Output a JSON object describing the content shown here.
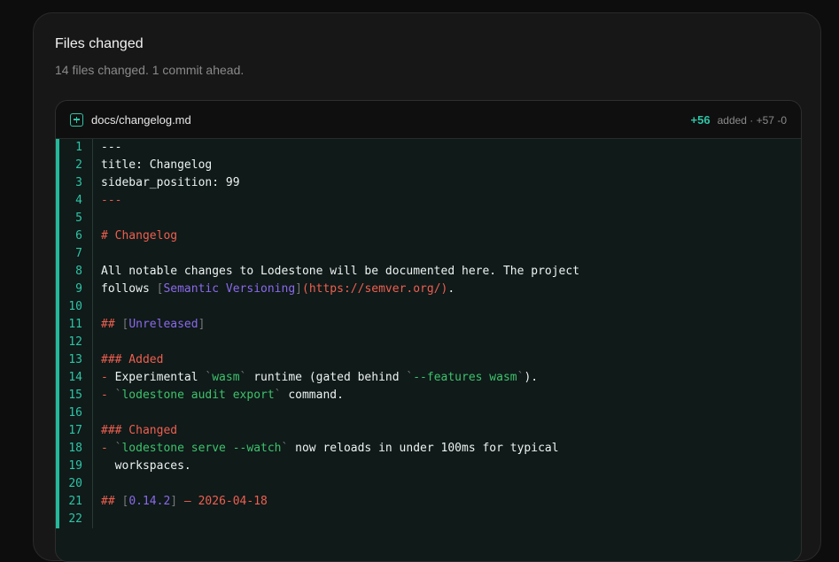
{
  "card": {
    "title": "Files changed",
    "subtitle": "14 files changed. 1 commit ahead."
  },
  "file": {
    "name": "docs/changelog.md",
    "additions": "+56",
    "status": "added · +57 -0",
    "icon": "plus-square-icon"
  },
  "colors": {
    "accent": "#2fc4a6",
    "heading": "#ef5f4f",
    "link": "#8b69ea",
    "code": "#3ec26c"
  },
  "lines": [
    {
      "n": "1",
      "segs": [
        {
          "t": "---",
          "c": ""
        }
      ]
    },
    {
      "n": "2",
      "segs": [
        {
          "t": "title: Changelog",
          "c": ""
        }
      ]
    },
    {
      "n": "3",
      "segs": [
        {
          "t": "sidebar_position: 99",
          "c": ""
        }
      ]
    },
    {
      "n": "4",
      "segs": [
        {
          "t": "---",
          "c": "t-dash"
        }
      ]
    },
    {
      "n": "5",
      "segs": []
    },
    {
      "n": "6",
      "segs": [
        {
          "t": "# Changelog",
          "c": "t-head"
        }
      ]
    },
    {
      "n": "7",
      "segs": []
    },
    {
      "n": "8",
      "segs": [
        {
          "t": "All notable changes to Lodestone will be documented here. The project",
          "c": ""
        }
      ]
    },
    {
      "n": "9",
      "segs": [
        {
          "t": "follows ",
          "c": ""
        },
        {
          "t": "[",
          "c": "t-bracket"
        },
        {
          "t": "Semantic Versioning",
          "c": "t-link"
        },
        {
          "t": "]",
          "c": "t-bracket"
        },
        {
          "t": "(https://semver.org/)",
          "c": "t-url"
        },
        {
          "t": ".",
          "c": ""
        }
      ]
    },
    {
      "n": "10",
      "segs": []
    },
    {
      "n": "11",
      "segs": [
        {
          "t": "## ",
          "c": "t-head"
        },
        {
          "t": "[",
          "c": "t-bracket"
        },
        {
          "t": "Unreleased",
          "c": "t-link"
        },
        {
          "t": "]",
          "c": "t-bracket"
        }
      ]
    },
    {
      "n": "12",
      "segs": []
    },
    {
      "n": "13",
      "segs": [
        {
          "t": "### Added",
          "c": "t-head"
        }
      ]
    },
    {
      "n": "14",
      "segs": [
        {
          "t": "- ",
          "c": "t-bullet"
        },
        {
          "t": "Experimental ",
          "c": ""
        },
        {
          "t": "`",
          "c": "t-tick"
        },
        {
          "t": "wasm",
          "c": "t-code"
        },
        {
          "t": "`",
          "c": "t-tick"
        },
        {
          "t": " runtime (gated behind ",
          "c": ""
        },
        {
          "t": "`",
          "c": "t-tick"
        },
        {
          "t": "--features wasm",
          "c": "t-code"
        },
        {
          "t": "`",
          "c": "t-tick"
        },
        {
          "t": ").",
          "c": ""
        }
      ]
    },
    {
      "n": "15",
      "segs": [
        {
          "t": "- ",
          "c": "t-bullet"
        },
        {
          "t": "`",
          "c": "t-tick"
        },
        {
          "t": "lodestone audit export",
          "c": "t-code"
        },
        {
          "t": "`",
          "c": "t-tick"
        },
        {
          "t": " command.",
          "c": ""
        }
      ]
    },
    {
      "n": "16",
      "segs": []
    },
    {
      "n": "17",
      "segs": [
        {
          "t": "### Changed",
          "c": "t-head"
        }
      ]
    },
    {
      "n": "18",
      "segs": [
        {
          "t": "- ",
          "c": "t-bullet"
        },
        {
          "t": "`",
          "c": "t-tick"
        },
        {
          "t": "lodestone serve --watch",
          "c": "t-code"
        },
        {
          "t": "`",
          "c": "t-tick"
        },
        {
          "t": " now reloads in under 100ms for typical",
          "c": ""
        }
      ]
    },
    {
      "n": "19",
      "segs": [
        {
          "t": "  workspaces.",
          "c": ""
        }
      ]
    },
    {
      "n": "20",
      "segs": []
    },
    {
      "n": "21",
      "segs": [
        {
          "t": "## ",
          "c": "t-head"
        },
        {
          "t": "[",
          "c": "t-bracket"
        },
        {
          "t": "0.14.2",
          "c": "t-link"
        },
        {
          "t": "]",
          "c": "t-bracket"
        },
        {
          "t": " — 2026-04-18",
          "c": "t-head"
        }
      ]
    },
    {
      "n": "22",
      "segs": []
    }
  ]
}
